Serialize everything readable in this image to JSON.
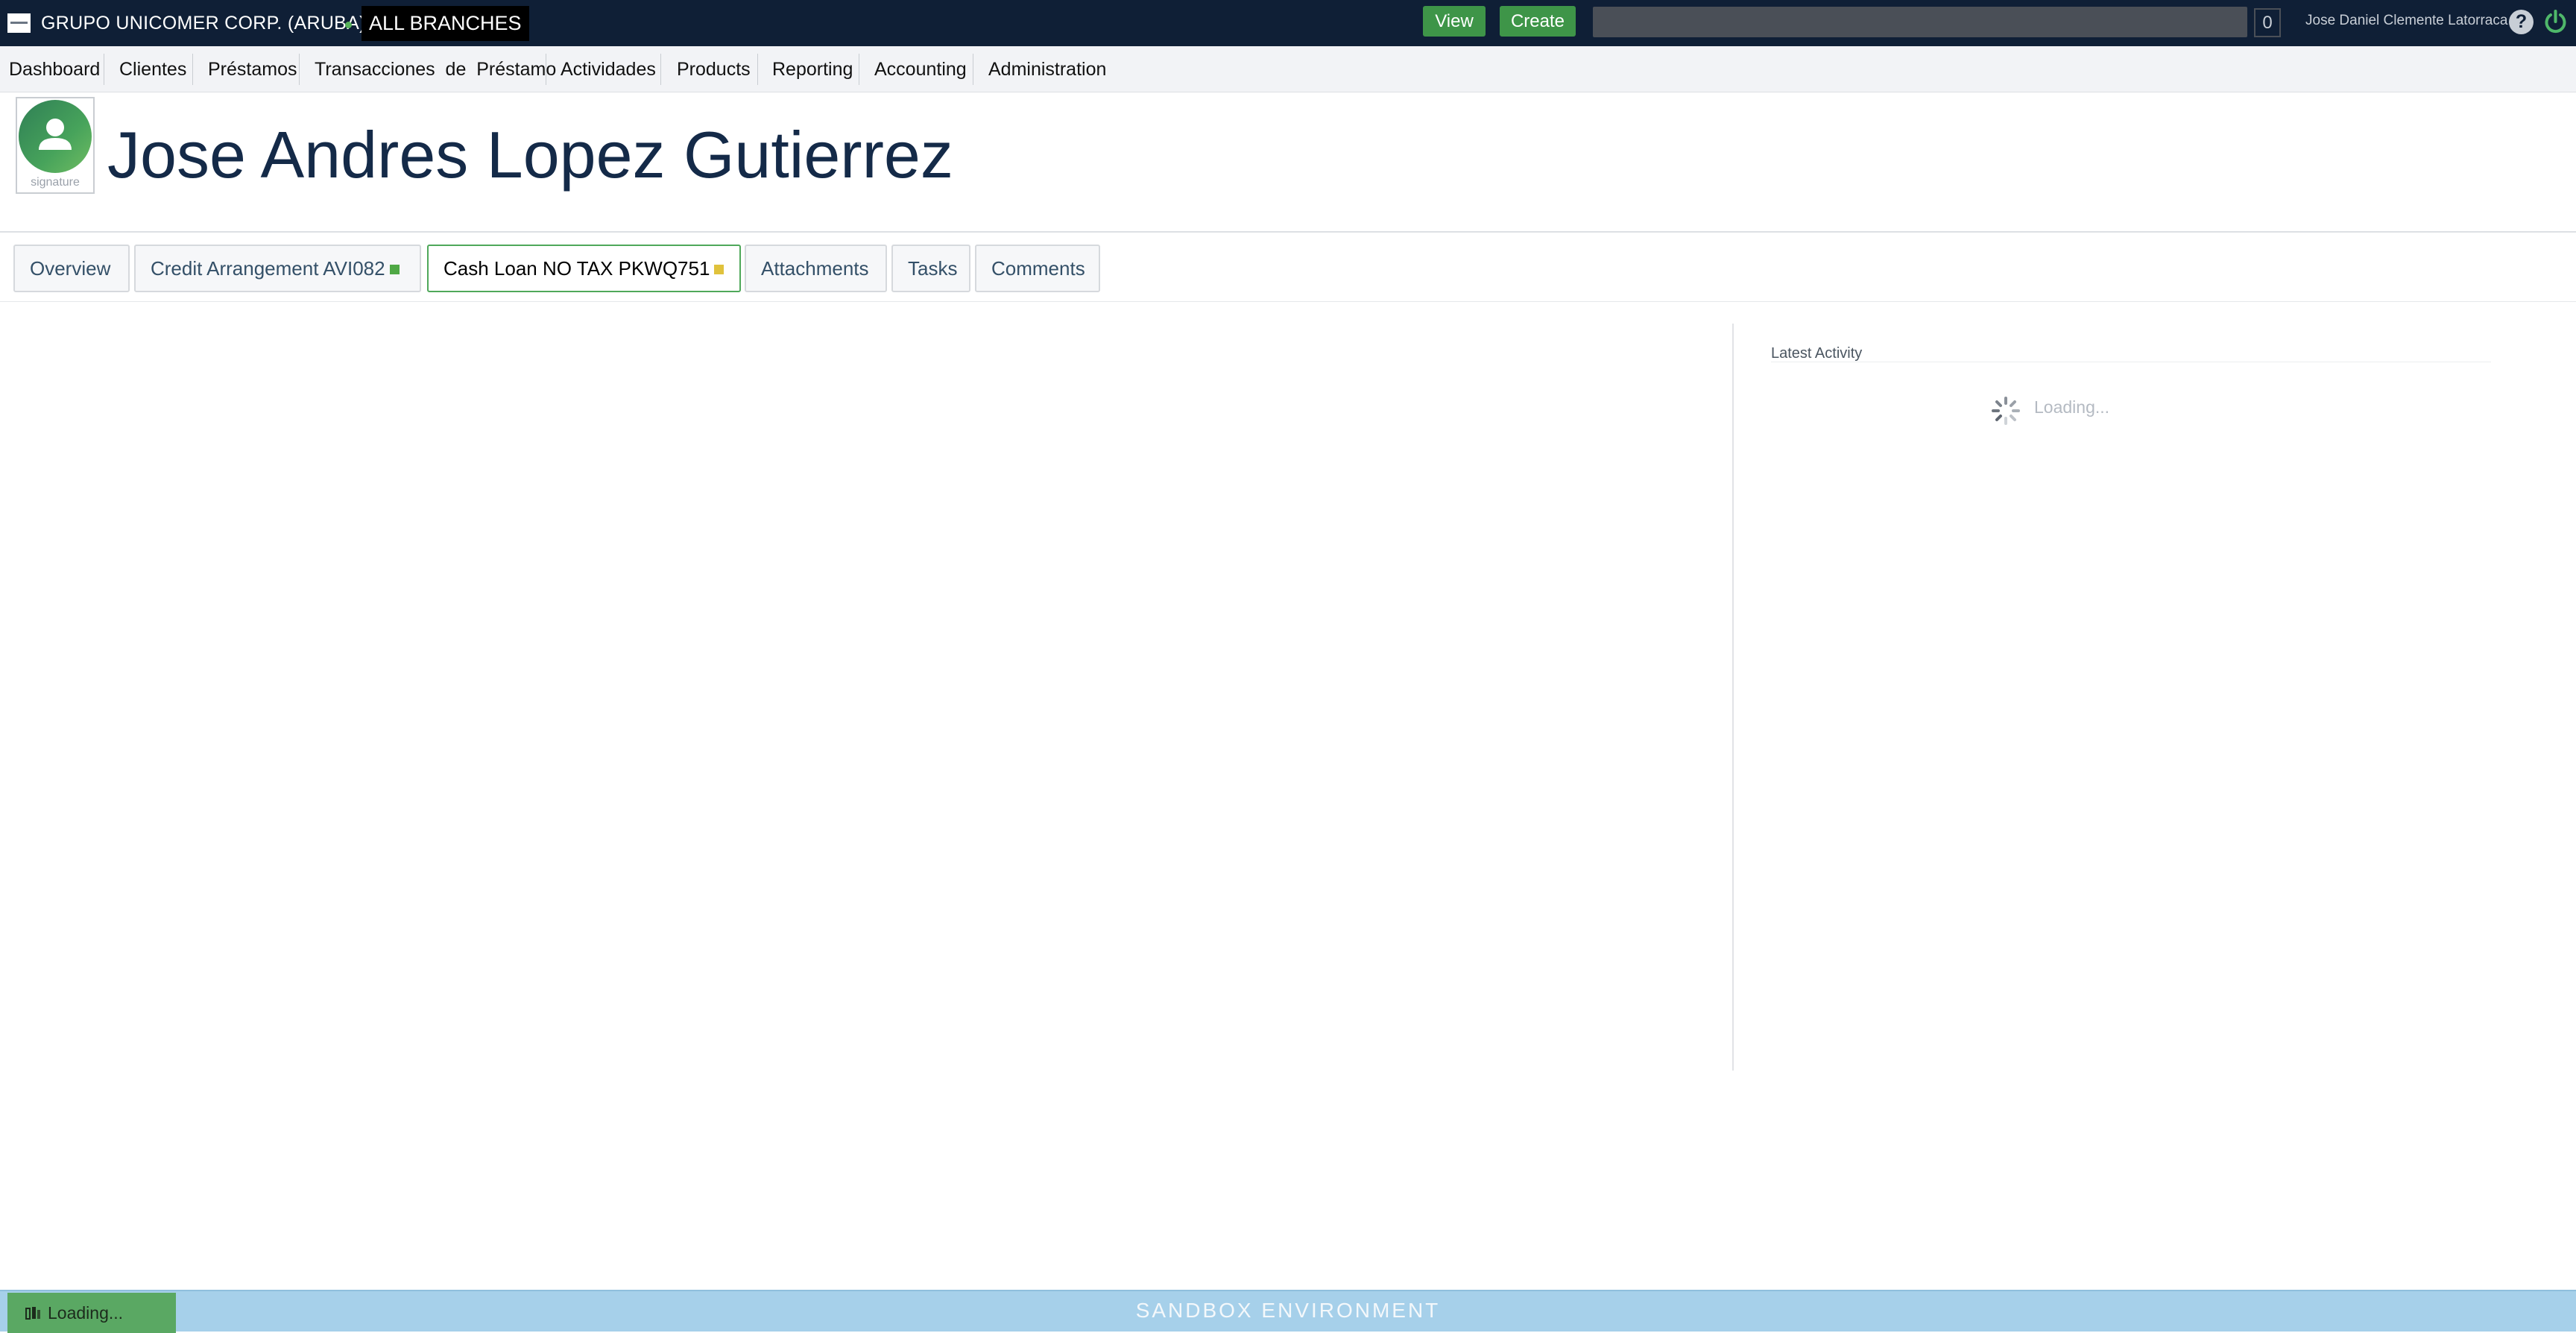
{
  "topbar": {
    "org_name": "GRUPO UNICOMER CORP. (ARUBA)",
    "branch": "ALL BRANCHES",
    "view_label": "View",
    "create_label": "Create",
    "search_placeholder": "",
    "counter": "0",
    "user_name": "Jose Daniel Clemente Latorraca",
    "help_label": "?"
  },
  "menu": {
    "items": [
      {
        "label": "Dashboard"
      },
      {
        "label": "Clientes"
      },
      {
        "label": "Préstamos"
      },
      {
        "label": "Transacciones  de  Préstamo"
      },
      {
        "label": "Actividades"
      },
      {
        "label": "Products"
      },
      {
        "label": "Reporting"
      },
      {
        "label": "Accounting"
      },
      {
        "label": "Administration"
      }
    ]
  },
  "client": {
    "name": "Jose Andres Lopez Gutierrez",
    "avatar_label": "signature"
  },
  "tabs": [
    {
      "label": "Overview",
      "active": false
    },
    {
      "label": "Credit Arrangement AVI082",
      "active": false,
      "status_color": "#4fa845"
    },
    {
      "label": "Cash Loan NO TAX PKWQ751",
      "active": true,
      "status_color": "#e0c23c"
    },
    {
      "label": "Attachments",
      "active": false
    },
    {
      "label": "Tasks",
      "active": false
    },
    {
      "label": "Comments",
      "active": false
    }
  ],
  "activity": {
    "title": "Latest Activity",
    "loading_text": "Loading..."
  },
  "footer": {
    "environment": "SANDBOX ENVIRONMENT",
    "loading_text": "Loading..."
  },
  "colors": {
    "topbar_bg": "#0f1f36",
    "accent_green": "#3e9548",
    "footer_bg": "#a6d0ea"
  }
}
